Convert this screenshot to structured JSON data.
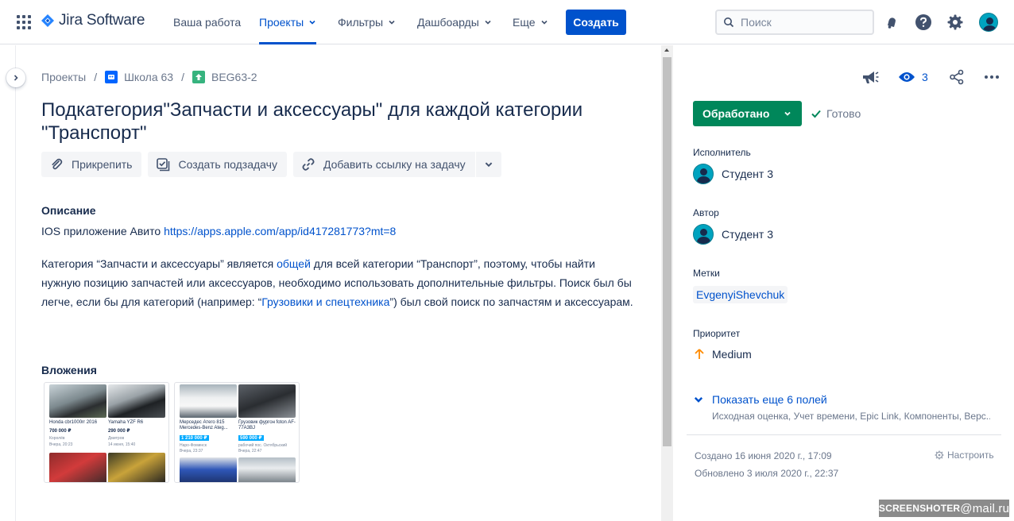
{
  "app": {
    "name": "Jira Software"
  },
  "nav": {
    "items": [
      {
        "label": "Ваша работа",
        "dropdown": false,
        "active": false
      },
      {
        "label": "Проекты",
        "dropdown": true,
        "active": true
      },
      {
        "label": "Фильтры",
        "dropdown": true,
        "active": false
      },
      {
        "label": "Дашбоарды",
        "dropdown": true,
        "active": false
      },
      {
        "label": "Еще",
        "dropdown": true,
        "active": false
      }
    ],
    "create_label": "Создать",
    "search_placeholder": "Поиск"
  },
  "breadcrumb": {
    "root": "Проекты",
    "project": "Школа 63",
    "issue_key": "BEG63-2"
  },
  "issue": {
    "title": "Подкатегория\"Запчасти и аксессуары\" для каждой категории \"Транспорт\"",
    "actions": {
      "attach": "Прикрепить",
      "create_subtask": "Создать подзадачу",
      "add_link": "Добавить ссылку на задачу"
    },
    "description": {
      "heading": "Описание",
      "line1_text": "IOS приложение Авито ",
      "line1_link": "https://apps.apple.com/app/id417281773?mt=8",
      "para_part1": "Категория “Запчасти и аксессуары” является ",
      "para_link1": "общей",
      "para_part2": " для всей категории “Транспорт”, поэтому, чтобы найти нужную позицию запчастей или аксессуаров, необходимо использовать дополнительные фильтры. Поиск был бы легче, если бы для категорий (например: “",
      "para_link2": "Грузовики и спецтехника",
      "para_part3": "”) был свой поиск по запчастям и аксессуарам."
    },
    "attachments_heading": "Вложения",
    "attachments": [
      {
        "items": [
          {
            "caption": "Honda cbr1000rr 2016",
            "price": "700 000 ₽",
            "meta1": "Королёв",
            "meta2": "Вчера, 20:23",
            "highlight": false
          },
          {
            "caption": "Yamaha YZF R6",
            "price": "290 000 ₽",
            "meta1": "Дмитров",
            "meta2": "14 июня, 15:40",
            "highlight": false
          }
        ]
      },
      {
        "items": [
          {
            "caption": "Мерседес Атего 815 Mercedes-Benz Ateg...",
            "price": "1 210 000 ₽",
            "meta1": "Наро-Фоминск",
            "meta2": "Вчера, 23:37",
            "highlight": true
          },
          {
            "caption": "Грузовик фургон foton AF-77A3BJ",
            "price": "590 000 ₽",
            "meta1": "рабочий пос. Октябрьский",
            "meta2": "Вчера, 22:47",
            "highlight": true
          }
        ]
      }
    ]
  },
  "sidebar": {
    "watchers_count": "3",
    "status_label": "Обработано",
    "resolution_label": "Готово",
    "assignee_label": "Исполнитель",
    "assignee": "Студент 3",
    "reporter_label": "Автор",
    "reporter": "Студент 3",
    "labels_label": "Метки",
    "labels": [
      "EvgenyiShevchuk"
    ],
    "priority_label": "Приоритет",
    "priority": "Medium",
    "show_more": "Показать еще 6 полей",
    "show_more_sub": "Исходная оценка, Учет времени, Epic Link, Компоненты, Верс...",
    "created": "Создано 16 июня 2020 г., 17:09",
    "updated": "Обновлено 3 июля 2020 г., 22:37",
    "configure": "Настроить"
  },
  "watermark": {
    "brand": "SCREENSHOTER",
    "at": "@mail.ru"
  },
  "colors": {
    "brand_blue": "#0052cc",
    "status_green": "#00875a",
    "priority_orange": "#ff8b00",
    "text_dark": "#172b4d",
    "text_muted": "#6b778c"
  }
}
